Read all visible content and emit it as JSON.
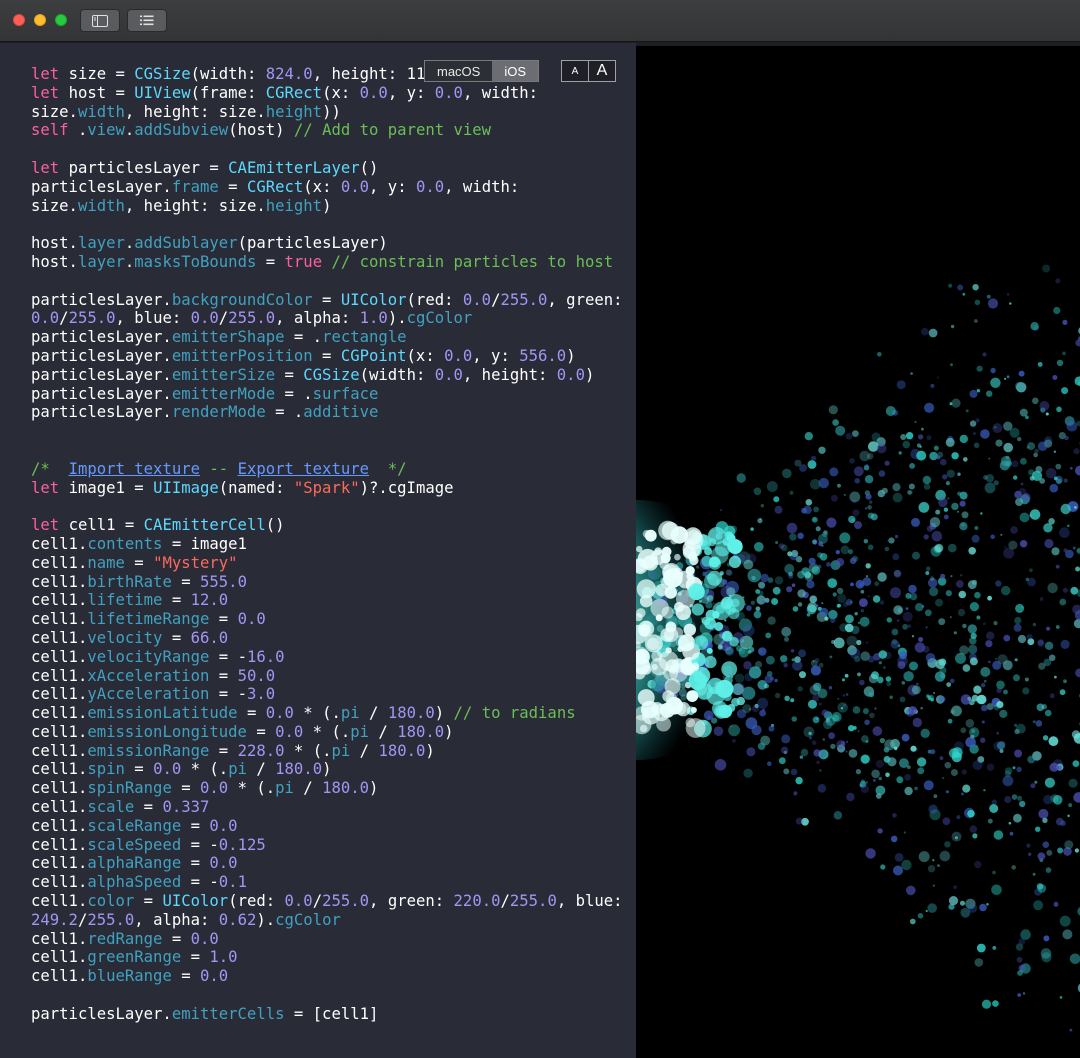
{
  "toolbar": {
    "sidebar_icon": "sidebar-icon",
    "list_icon": "list-icon"
  },
  "platform": {
    "options": [
      "macOS",
      "iOS"
    ],
    "selected": "iOS"
  },
  "font_size": {
    "small": "A",
    "large": "A"
  },
  "code_lines": [
    [
      [
        "k",
        "let"
      ],
      [
        "",
        "size = "
      ],
      [
        "t",
        "CGSize"
      ],
      [
        "",
        "(width: "
      ],
      [
        "n",
        "824.0"
      ],
      [
        "",
        ", height: 11"
      ]
    ],
    [
      [
        "k",
        "let"
      ],
      [
        "",
        "host = "
      ],
      [
        "t",
        "UIView"
      ],
      [
        "",
        "(frame: "
      ],
      [
        "t",
        "CGRect"
      ],
      [
        "",
        "(x: "
      ],
      [
        "n",
        "0.0"
      ],
      [
        "",
        ", y: "
      ],
      [
        "n",
        "0.0"
      ],
      [
        "",
        ", width:"
      ]
    ],
    [
      [
        "",
        "size."
      ],
      [
        "p",
        "width"
      ],
      [
        "",
        ", height: size."
      ],
      [
        "p",
        "height"
      ],
      [
        "",
        "))"
      ]
    ],
    [
      [
        "k",
        "self"
      ],
      [
        "",
        "."
      ],
      [
        "p",
        "view"
      ],
      [
        "",
        "."
      ],
      [
        "p",
        "addSubview"
      ],
      [
        "",
        "(host) "
      ],
      [
        "c",
        "// Add to parent view"
      ]
    ],
    [],
    [
      [
        "k",
        "let"
      ],
      [
        "",
        "particlesLayer = "
      ],
      [
        "t",
        "CAEmitterLayer"
      ],
      [
        "",
        "()"
      ]
    ],
    [
      [
        "",
        "particlesLayer."
      ],
      [
        "p",
        "frame"
      ],
      [
        "",
        " = "
      ],
      [
        "t",
        "CGRect"
      ],
      [
        "",
        "(x: "
      ],
      [
        "n",
        "0.0"
      ],
      [
        "",
        ", y: "
      ],
      [
        "n",
        "0.0"
      ],
      [
        "",
        ", width:"
      ]
    ],
    [
      [
        "",
        "size."
      ],
      [
        "p",
        "width"
      ],
      [
        "",
        ", height: size."
      ],
      [
        "p",
        "height"
      ],
      [
        "",
        ")"
      ]
    ],
    [],
    [
      [
        "",
        "host."
      ],
      [
        "p",
        "layer"
      ],
      [
        "",
        "."
      ],
      [
        "p",
        "addSublayer"
      ],
      [
        "",
        "(particlesLayer)"
      ]
    ],
    [
      [
        "",
        "host."
      ],
      [
        "p",
        "layer"
      ],
      [
        "",
        "."
      ],
      [
        "p",
        "masksToBounds"
      ],
      [
        "",
        " = "
      ],
      [
        "k",
        "true"
      ],
      [
        "",
        " "
      ],
      [
        "c",
        "// constrain particles to host"
      ]
    ],
    [],
    [
      [
        "",
        "particlesLayer."
      ],
      [
        "p",
        "backgroundColor"
      ],
      [
        "",
        " = "
      ],
      [
        "t",
        "UIColor"
      ],
      [
        "",
        "(red: "
      ],
      [
        "n",
        "0.0"
      ],
      [
        "",
        "/"
      ],
      [
        "n",
        "255.0"
      ],
      [
        "",
        ", green:"
      ]
    ],
    [
      [
        "n",
        "0.0"
      ],
      [
        "",
        "/"
      ],
      [
        "n",
        "255.0"
      ],
      [
        "",
        ", blue: "
      ],
      [
        "n",
        "0.0"
      ],
      [
        "",
        "/"
      ],
      [
        "n",
        "255.0"
      ],
      [
        "",
        ", alpha: "
      ],
      [
        "n",
        "1.0"
      ],
      [
        "",
        ")."
      ],
      [
        "p",
        "cgColor"
      ]
    ],
    [
      [
        "",
        "particlesLayer."
      ],
      [
        "p",
        "emitterShape"
      ],
      [
        "",
        " = ."
      ],
      [
        "p",
        "rectangle"
      ]
    ],
    [
      [
        "",
        "particlesLayer."
      ],
      [
        "p",
        "emitterPosition"
      ],
      [
        "",
        " = "
      ],
      [
        "t",
        "CGPoint"
      ],
      [
        "",
        "(x: "
      ],
      [
        "n",
        "0.0"
      ],
      [
        "",
        ", y: "
      ],
      [
        "n",
        "556.0"
      ],
      [
        "",
        ")"
      ]
    ],
    [
      [
        "",
        "particlesLayer."
      ],
      [
        "p",
        "emitterSize"
      ],
      [
        "",
        " = "
      ],
      [
        "t",
        "CGSize"
      ],
      [
        "",
        "(width: "
      ],
      [
        "n",
        "0.0"
      ],
      [
        "",
        ", height: "
      ],
      [
        "n",
        "0.0"
      ],
      [
        "",
        ")"
      ]
    ],
    [
      [
        "",
        "particlesLayer."
      ],
      [
        "p",
        "emitterMode"
      ],
      [
        "",
        " = ."
      ],
      [
        "p",
        "surface"
      ]
    ],
    [
      [
        "",
        "particlesLayer."
      ],
      [
        "p",
        "renderMode"
      ],
      [
        "",
        " = ."
      ],
      [
        "p",
        "additive"
      ]
    ],
    [],
    [],
    [
      [
        "c",
        "/*  "
      ],
      [
        "lk",
        "Import texture"
      ],
      [
        "c",
        " -- "
      ],
      [
        "lk",
        "Export texture"
      ],
      [
        "c",
        "  */"
      ]
    ],
    [
      [
        "k",
        "let"
      ],
      [
        "",
        "image1 = "
      ],
      [
        "t",
        "UIImage"
      ],
      [
        "",
        "(named: "
      ],
      [
        "s",
        "\"Spark\""
      ],
      [
        "",
        ")?.cgImage"
      ]
    ],
    [],
    [
      [
        "k",
        "let"
      ],
      [
        "",
        "cell1 = "
      ],
      [
        "t",
        "CAEmitterCell"
      ],
      [
        "",
        "()"
      ]
    ],
    [
      [
        "",
        "cell1."
      ],
      [
        "p",
        "contents"
      ],
      [
        "",
        " = image1"
      ]
    ],
    [
      [
        "",
        "cell1."
      ],
      [
        "p",
        "name"
      ],
      [
        "",
        " = "
      ],
      [
        "s",
        "\"Mystery\""
      ]
    ],
    [
      [
        "",
        "cell1."
      ],
      [
        "p",
        "birthRate"
      ],
      [
        "",
        " = "
      ],
      [
        "n",
        "555.0"
      ]
    ],
    [
      [
        "",
        "cell1."
      ],
      [
        "p",
        "lifetime"
      ],
      [
        "",
        " = "
      ],
      [
        "n",
        "12.0"
      ]
    ],
    [
      [
        "",
        "cell1."
      ],
      [
        "p",
        "lifetimeRange"
      ],
      [
        "",
        " = "
      ],
      [
        "n",
        "0.0"
      ]
    ],
    [
      [
        "",
        "cell1."
      ],
      [
        "p",
        "velocity"
      ],
      [
        "",
        " = "
      ],
      [
        "n",
        "66.0"
      ]
    ],
    [
      [
        "",
        "cell1."
      ],
      [
        "p",
        "velocityRange"
      ],
      [
        "",
        " = -"
      ],
      [
        "n",
        "16.0"
      ]
    ],
    [
      [
        "",
        "cell1."
      ],
      [
        "p",
        "xAcceleration"
      ],
      [
        "",
        " = "
      ],
      [
        "n",
        "50.0"
      ]
    ],
    [
      [
        "",
        "cell1."
      ],
      [
        "p",
        "yAcceleration"
      ],
      [
        "",
        " = -"
      ],
      [
        "n",
        "3.0"
      ]
    ],
    [
      [
        "",
        "cell1."
      ],
      [
        "p",
        "emissionLatitude"
      ],
      [
        "",
        " = "
      ],
      [
        "n",
        "0.0"
      ],
      [
        "",
        " * (."
      ],
      [
        "p",
        "pi"
      ],
      [
        "",
        " / "
      ],
      [
        "n",
        "180.0"
      ],
      [
        "",
        ") "
      ],
      [
        "c",
        "// to radians"
      ]
    ],
    [
      [
        "",
        "cell1."
      ],
      [
        "p",
        "emissionLongitude"
      ],
      [
        "",
        " = "
      ],
      [
        "n",
        "0.0"
      ],
      [
        "",
        " * (."
      ],
      [
        "p",
        "pi"
      ],
      [
        "",
        " / "
      ],
      [
        "n",
        "180.0"
      ],
      [
        "",
        ")"
      ]
    ],
    [
      [
        "",
        "cell1."
      ],
      [
        "p",
        "emissionRange"
      ],
      [
        "",
        " = "
      ],
      [
        "n",
        "228.0"
      ],
      [
        "",
        " * (."
      ],
      [
        "p",
        "pi"
      ],
      [
        "",
        " / "
      ],
      [
        "n",
        "180.0"
      ],
      [
        "",
        ")"
      ]
    ],
    [
      [
        "",
        "cell1."
      ],
      [
        "p",
        "spin"
      ],
      [
        "",
        " = "
      ],
      [
        "n",
        "0.0"
      ],
      [
        "",
        " * (."
      ],
      [
        "p",
        "pi"
      ],
      [
        "",
        " / "
      ],
      [
        "n",
        "180.0"
      ],
      [
        "",
        ")"
      ]
    ],
    [
      [
        "",
        "cell1."
      ],
      [
        "p",
        "spinRange"
      ],
      [
        "",
        " = "
      ],
      [
        "n",
        "0.0"
      ],
      [
        "",
        " * (."
      ],
      [
        "p",
        "pi"
      ],
      [
        "",
        " / "
      ],
      [
        "n",
        "180.0"
      ],
      [
        "",
        ")"
      ]
    ],
    [
      [
        "",
        "cell1."
      ],
      [
        "p",
        "scale"
      ],
      [
        "",
        " = "
      ],
      [
        "n",
        "0.337"
      ]
    ],
    [
      [
        "",
        "cell1."
      ],
      [
        "p",
        "scaleRange"
      ],
      [
        "",
        " = "
      ],
      [
        "n",
        "0.0"
      ]
    ],
    [
      [
        "",
        "cell1."
      ],
      [
        "p",
        "scaleSpeed"
      ],
      [
        "",
        " = -"
      ],
      [
        "n",
        "0.125"
      ]
    ],
    [
      [
        "",
        "cell1."
      ],
      [
        "p",
        "alphaRange"
      ],
      [
        "",
        " = "
      ],
      [
        "n",
        "0.0"
      ]
    ],
    [
      [
        "",
        "cell1."
      ],
      [
        "p",
        "alphaSpeed"
      ],
      [
        "",
        " = -"
      ],
      [
        "n",
        "0.1"
      ]
    ],
    [
      [
        "",
        "cell1."
      ],
      [
        "p",
        "color"
      ],
      [
        "",
        " = "
      ],
      [
        "t",
        "UIColor"
      ],
      [
        "",
        "(red: "
      ],
      [
        "n",
        "0.0"
      ],
      [
        "",
        "/"
      ],
      [
        "n",
        "255.0"
      ],
      [
        "",
        ", green: "
      ],
      [
        "n",
        "220.0"
      ],
      [
        "",
        "/"
      ],
      [
        "n",
        "255.0"
      ],
      [
        "",
        ", blue:"
      ]
    ],
    [
      [
        "n",
        "249.2"
      ],
      [
        "",
        "/"
      ],
      [
        "n",
        "255.0"
      ],
      [
        "",
        ", alpha: "
      ],
      [
        "n",
        "0.62"
      ],
      [
        "",
        ")."
      ],
      [
        "p",
        "cgColor"
      ]
    ],
    [
      [
        "",
        "cell1."
      ],
      [
        "p",
        "redRange"
      ],
      [
        "",
        " = "
      ],
      [
        "n",
        "0.0"
      ]
    ],
    [
      [
        "",
        "cell1."
      ],
      [
        "p",
        "greenRange"
      ],
      [
        "",
        " = "
      ],
      [
        "n",
        "1.0"
      ]
    ],
    [
      [
        "",
        "cell1."
      ],
      [
        "p",
        "blueRange"
      ],
      [
        "",
        " = "
      ],
      [
        "n",
        "0.0"
      ]
    ],
    [],
    [
      [
        "",
        "particlesLayer."
      ],
      [
        "p",
        "emitterCells"
      ],
      [
        "",
        " = [cell1]"
      ]
    ]
  ]
}
